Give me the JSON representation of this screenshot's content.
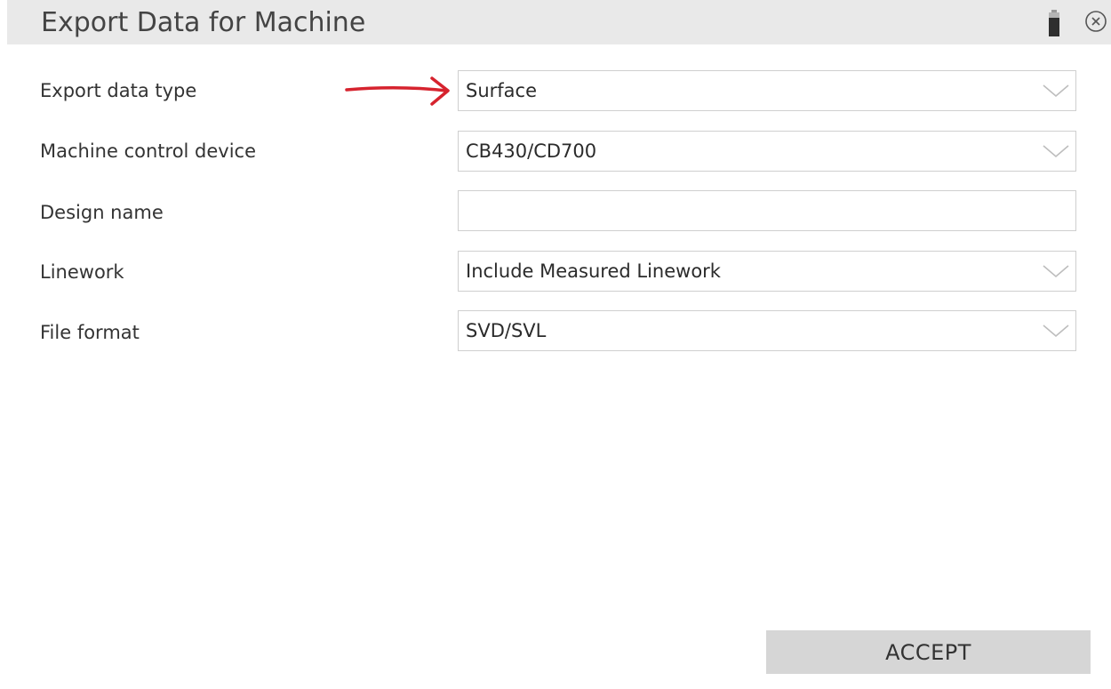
{
  "window": {
    "title": "Export Data for Machine",
    "icons": [
      "battery-icon",
      "close-circle-icon"
    ]
  },
  "form": {
    "export_data_type": {
      "label": "Export data type",
      "value": "Surface"
    },
    "machine_control_device": {
      "label": "Machine control device",
      "value": "CB430/CD700"
    },
    "design_name": {
      "label": "Design name",
      "value": ""
    },
    "linework": {
      "label": "Linework",
      "value": "Include Measured Linework"
    },
    "file_format": {
      "label": "File format",
      "value": "SVD/SVL"
    }
  },
  "annotation": {
    "arrow_color": "#d6232e"
  },
  "actions": {
    "accept_label": "ACCEPT"
  }
}
